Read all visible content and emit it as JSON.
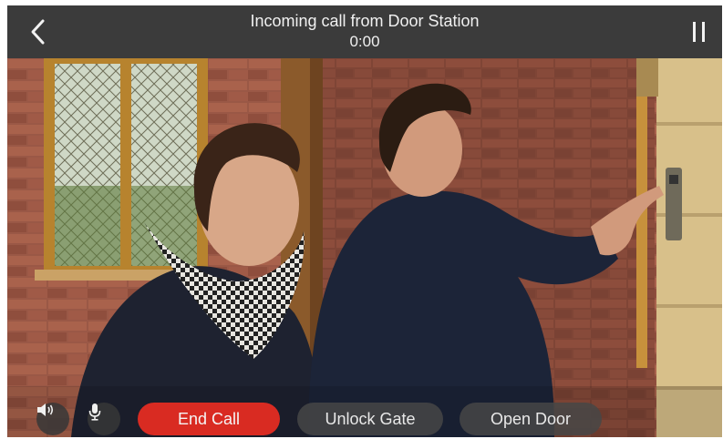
{
  "header": {
    "title": "Incoming call from Door Station",
    "timer": "0:00"
  },
  "controls": {
    "end_call": "End Call",
    "unlock_gate": "Unlock Gate",
    "open_door": "Open Door"
  },
  "icons": {
    "back": "chevron-left-icon",
    "pause": "pause-icon",
    "speaker": "speaker-icon",
    "microphone": "microphone-icon"
  },
  "colors": {
    "header_bg": "#3b3b3b",
    "end_call_bg": "#d92b22",
    "secondary_btn_bg": "#464646"
  }
}
